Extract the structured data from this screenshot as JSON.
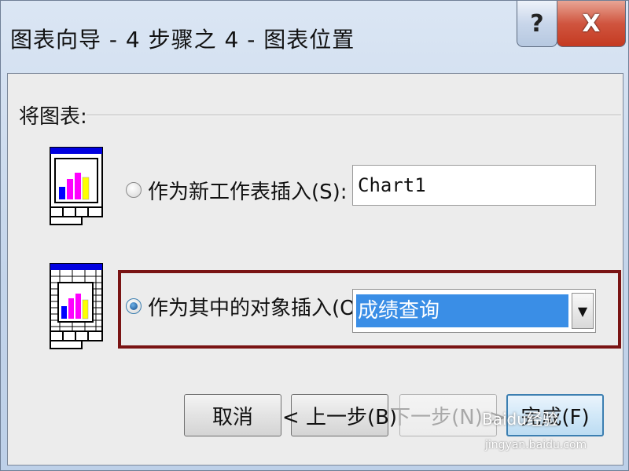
{
  "window": {
    "title": "图表向导 - 4 步骤之 4 - 图表位置",
    "help_label": "?",
    "close_label": "X"
  },
  "group": {
    "label": "将图表:"
  },
  "options": {
    "new_sheet": {
      "label": "作为新工作表插入(S):",
      "value": "Chart1",
      "selected": false
    },
    "object": {
      "label": "作为其中的对象插入(O):",
      "selected_value": "成绩查询",
      "selected": true
    }
  },
  "buttons": {
    "cancel": "取消",
    "back": "< 上一步(B)",
    "next": "下一步(N) >",
    "finish": "完成(F)"
  },
  "watermark": {
    "brand": "Baidu经验",
    "url": "jingyan.baidu.com"
  },
  "colors": {
    "highlight_box": "#7a1414",
    "selection": "#3a8ee6",
    "close_button": "#c43a22"
  }
}
